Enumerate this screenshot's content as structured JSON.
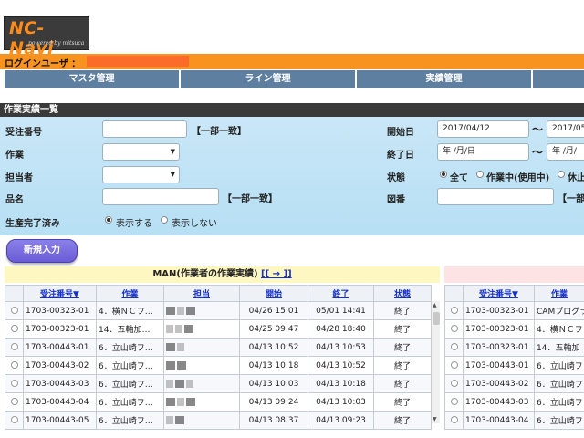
{
  "logo": {
    "name": "NC-Navi",
    "tagline": "powered by mitsuca"
  },
  "userbar": {
    "label": "ログインユーザ ："
  },
  "nav": {
    "items": [
      "マスタ管理",
      "ライン管理",
      "実績管理"
    ]
  },
  "section": {
    "title": "作業実績一覧"
  },
  "search": {
    "order_no_label": "受注番号",
    "partial_match": "【一部一致】",
    "work_label": "作業",
    "owner_label": "担当者",
    "product_label": "品名",
    "done_label": "生産完了済み",
    "show": "表示する",
    "hide": "表示しない",
    "start_label": "開始日",
    "start_from": "2017/04/12",
    "start_to": "2017/05/",
    "end_label": "終了日",
    "end_from_placeholder": "年 /月/日",
    "end_to_placeholder": "年 /月/",
    "status_label": "状態",
    "status_all": "全て",
    "status_working": "作業中(使用中)",
    "status_paused": "休止",
    "drawing_label": "図番",
    "partial_match_cut": "【一部",
    "tilde": "～"
  },
  "new_button": "新規入力",
  "left_panel": {
    "title": "MAN(作業者の作業実績)",
    "link": "[[ → ]]",
    "headers": [
      "受注番号▼",
      "作業",
      "担当",
      "開始",
      "終了",
      "状態"
    ],
    "rows": [
      [
        "1703-00323-01",
        "4．横ＮＣフ…",
        "04/26 15:01",
        "05/01 14:41",
        "終了"
      ],
      [
        "1703-00323-01",
        "14．五軸加…",
        "04/25 09:47",
        "04/28 18:40",
        "終了"
      ],
      [
        "1703-00443-01",
        "6．立山崎フ…",
        "04/13 10:52",
        "04/13 10:53",
        "終了"
      ],
      [
        "1703-00443-02",
        "6．立山崎フ…",
        "04/13 10:18",
        "04/13 10:52",
        "終了"
      ],
      [
        "1703-00443-03",
        "6．立山崎フ…",
        "04/13 10:03",
        "04/13 10:18",
        "終了"
      ],
      [
        "1703-00443-04",
        "6．立山崎フ…",
        "04/13 09:24",
        "04/13 10:03",
        "終了"
      ],
      [
        "1703-00443-05",
        "6．立山崎フ…",
        "04/13 08:37",
        "04/13 09:23",
        "終了"
      ]
    ]
  },
  "right_panel": {
    "headers": [
      "受注番号▼",
      "作業"
    ],
    "rows": [
      [
        "1703-00323-01",
        "CAMプログラ"
      ],
      [
        "1703-00323-01",
        "4．横ＮＣフ"
      ],
      [
        "1703-00323-01",
        "14．五軸加"
      ],
      [
        "1703-00443-01",
        "6．立山崎フ"
      ],
      [
        "1703-00443-02",
        "6．立山崎フ"
      ],
      [
        "1703-00443-03",
        "6．立山崎フ"
      ],
      [
        "1703-00443-04",
        "6．立山崎フ"
      ]
    ]
  }
}
